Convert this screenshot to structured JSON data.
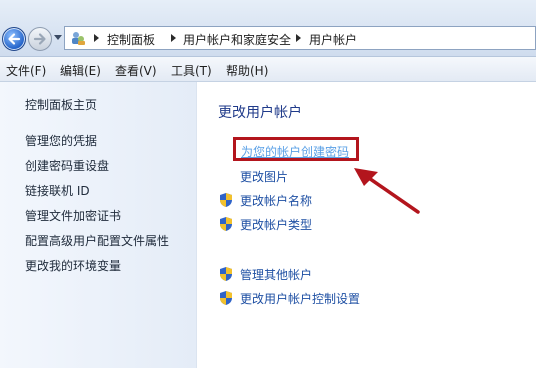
{
  "breadcrumb": {
    "items": [
      "控制面板",
      "用户帐户和家庭安全",
      "用户帐户"
    ]
  },
  "menu": {
    "items": [
      "文件(F)",
      "编辑(E)",
      "查看(V)",
      "工具(T)",
      "帮助(H)"
    ]
  },
  "sidebar": {
    "home": "控制面板主页",
    "links": [
      "管理您的凭据",
      "创建密码重设盘",
      "链接联机 ID",
      "管理文件加密证书",
      "配置高级用户配置文件属性",
      "更改我的环境变量"
    ]
  },
  "main": {
    "title": "更改用户帐户",
    "highlighted_task": "为您的帐户创建密码",
    "tasks": [
      "更改图片",
      "更改帐户名称",
      "更改帐户类型"
    ],
    "other_tasks": [
      "管理其他帐户",
      "更改用户帐户控制设置"
    ]
  },
  "colors": {
    "highlight_border": "#b3151d",
    "link": "#1e4fa3",
    "title": "#1f3a8a"
  }
}
